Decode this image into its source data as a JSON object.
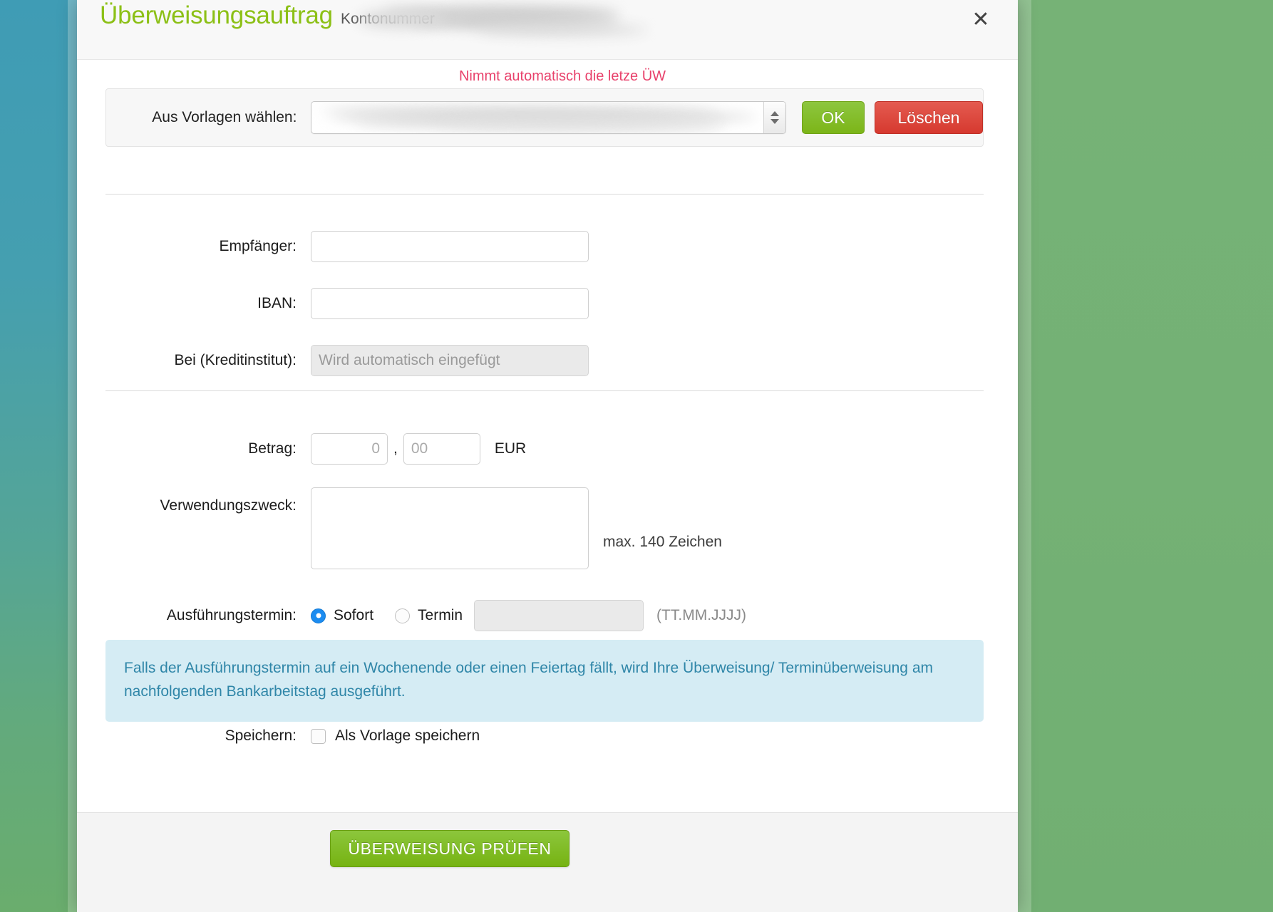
{
  "background": {
    "left_gradient_top": "#3f9cb5",
    "left_gradient_bottom": "#6aad6d",
    "right_color": "#74b175"
  },
  "header": {
    "title": "Überweisungsauftrag",
    "subtitle": "Kontonummer",
    "close_icon": "close-icon",
    "close_glyph": "✕"
  },
  "annotation": {
    "text": "Nimmt automatisch die letze ÜW",
    "color": "#e8416b"
  },
  "template_panel": {
    "label": "Aus Vorlagen wählen:",
    "select_value": "",
    "select_icon": "chevron-updown-icon",
    "ok_label": "OK",
    "ok_color": "#7cb518",
    "delete_label": "Löschen",
    "delete_color": "#d6392f"
  },
  "fields": {
    "empfaenger": {
      "label": "Empfänger:",
      "value": "",
      "placeholder": ""
    },
    "iban": {
      "label": "IBAN:",
      "value": "",
      "placeholder": ""
    },
    "kreditinstitut": {
      "label": "Bei (Kreditinstitut):",
      "value": "",
      "placeholder": "Wird automatisch eingefügt"
    },
    "betrag": {
      "label": "Betrag:",
      "euro_placeholder": "0",
      "separator": ",",
      "cent_placeholder": "00",
      "currency": "EUR"
    },
    "verwendungszweck": {
      "label": "Verwendungszweck:",
      "value": "",
      "hint": "max. 140 Zeichen"
    },
    "ausfuehrungstermin": {
      "label": "Ausführungstermin:",
      "option_sofort": "Sofort",
      "option_termin": "Termin",
      "selected": "Sofort",
      "date_value": "",
      "date_format_hint": "(TT.MM.JJJJ)"
    },
    "speichern": {
      "label": "Speichern:",
      "checkbox_label": "Als Vorlage speichern",
      "checked": false
    }
  },
  "info_box": {
    "text": "Falls der Ausführungstermin auf ein Wochenende oder einen Feiertag fällt, wird Ihre Überweisung/ Terminüberweisung am nachfolgenden Bankarbeitstag ausgeführt.",
    "background": "#d5ecf4",
    "text_color": "#2f86a8"
  },
  "footer": {
    "submit_label": "ÜBERWEISUNG PRÜFEN",
    "submit_color": "#76b312"
  }
}
